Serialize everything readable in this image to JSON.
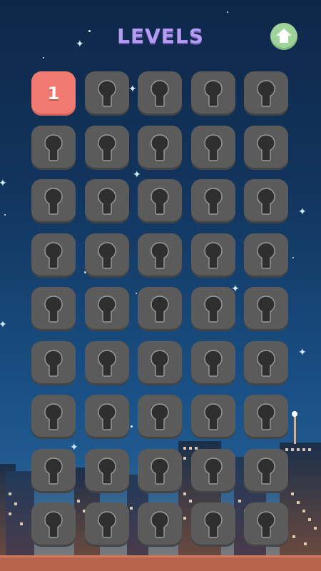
{
  "header": {
    "title": "LEVELS",
    "home_icon": "home-arrow-up-icon"
  },
  "levels": [
    {
      "label": "1",
      "locked": false
    },
    {
      "label": "",
      "locked": true
    },
    {
      "label": "",
      "locked": true
    },
    {
      "label": "",
      "locked": true
    },
    {
      "label": "",
      "locked": true
    },
    {
      "label": "",
      "locked": true
    },
    {
      "label": "",
      "locked": true
    },
    {
      "label": "",
      "locked": true
    },
    {
      "label": "",
      "locked": true
    },
    {
      "label": "",
      "locked": true
    },
    {
      "label": "",
      "locked": true
    },
    {
      "label": "",
      "locked": true
    },
    {
      "label": "",
      "locked": true
    },
    {
      "label": "",
      "locked": true
    },
    {
      "label": "",
      "locked": true
    },
    {
      "label": "",
      "locked": true
    },
    {
      "label": "",
      "locked": true
    },
    {
      "label": "",
      "locked": true
    },
    {
      "label": "",
      "locked": true
    },
    {
      "label": "",
      "locked": true
    },
    {
      "label": "",
      "locked": true
    },
    {
      "label": "",
      "locked": true
    },
    {
      "label": "",
      "locked": true
    },
    {
      "label": "",
      "locked": true
    },
    {
      "label": "",
      "locked": true
    },
    {
      "label": "",
      "locked": true
    },
    {
      "label": "",
      "locked": true
    },
    {
      "label": "",
      "locked": true
    },
    {
      "label": "",
      "locked": true
    },
    {
      "label": "",
      "locked": true
    },
    {
      "label": "",
      "locked": true
    },
    {
      "label": "",
      "locked": true
    },
    {
      "label": "",
      "locked": true
    },
    {
      "label": "",
      "locked": true
    },
    {
      "label": "",
      "locked": true
    },
    {
      "label": "",
      "locked": true
    },
    {
      "label": "",
      "locked": true
    },
    {
      "label": "",
      "locked": true
    },
    {
      "label": "",
      "locked": true
    },
    {
      "label": "",
      "locked": true
    },
    {
      "label": "",
      "locked": true
    },
    {
      "label": "",
      "locked": true
    },
    {
      "label": "",
      "locked": true
    },
    {
      "label": "",
      "locked": true
    },
    {
      "label": "",
      "locked": true
    }
  ],
  "icons": {
    "locked_tile": "keyhole-lock-icon"
  },
  "colors": {
    "title": "#b59cf2",
    "unlocked_tile": "#f27b71",
    "locked_tile": "#5b5b5b",
    "home_button": "#9fd39a"
  }
}
